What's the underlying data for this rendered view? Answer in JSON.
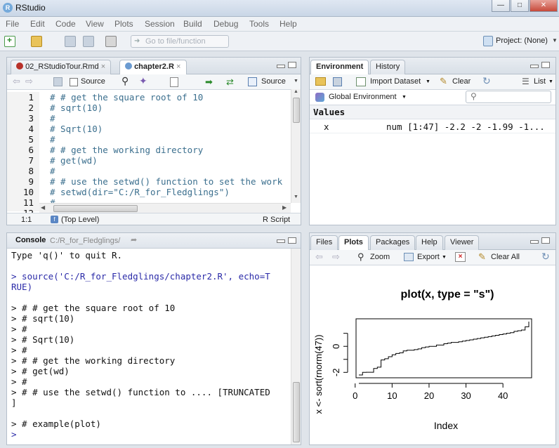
{
  "app": {
    "title": "RStudio"
  },
  "menu": [
    "File",
    "Edit",
    "Code",
    "View",
    "Plots",
    "Session",
    "Build",
    "Debug",
    "Tools",
    "Help"
  ],
  "toolbar": {
    "goto_placeholder": "Go to file/function",
    "project": "Project: (None)"
  },
  "editor": {
    "tabs": [
      "02_RStudioTour.Rmd",
      "chapter2.R"
    ],
    "source_on_save": "Source",
    "source_button": "Source",
    "line_numbers": [
      "1",
      "2",
      "3",
      "4",
      "5",
      "6",
      "7",
      "8",
      "9",
      "10",
      "11",
      "12"
    ],
    "lines": [
      "# # get the square root of 10",
      "# sqrt(10)",
      "#",
      "# Sqrt(10)",
      "#",
      "# # get the working directory",
      "# get(wd)",
      "#",
      "# # use the setwd() function to set the work",
      "# setwd(dir=\"C:/R_for_Fledglings\")",
      "#",
      ""
    ],
    "status_pos": "1:1",
    "status_scope": "(Top Level)",
    "status_type": "R Script"
  },
  "console": {
    "label": "Console",
    "path": "C:/R_for_Fledglings/",
    "lines": [
      {
        "t": "out",
        "v": "Type 'q()' to quit R."
      },
      {
        "t": "out",
        "v": ""
      },
      {
        "t": "in",
        "v": "> source('C:/R_for_Fledglings/chapter2.R', echo=T"
      },
      {
        "t": "in",
        "v": "RUE)"
      },
      {
        "t": "out",
        "v": ""
      },
      {
        "t": "out",
        "v": "> # # get the square root of 10"
      },
      {
        "t": "out",
        "v": "> # sqrt(10)"
      },
      {
        "t": "out",
        "v": "> #"
      },
      {
        "t": "out",
        "v": "> # Sqrt(10)"
      },
      {
        "t": "out",
        "v": "> #"
      },
      {
        "t": "out",
        "v": "> # # get the working directory"
      },
      {
        "t": "out",
        "v": "> # get(wd)"
      },
      {
        "t": "out",
        "v": "> #"
      },
      {
        "t": "out",
        "v": "> # # use the setwd() function to .... [TRUNCATED"
      },
      {
        "t": "out",
        "v": "]"
      },
      {
        "t": "out",
        "v": ""
      },
      {
        "t": "out",
        "v": "> # example(plot)"
      },
      {
        "t": "in",
        "v": "> "
      }
    ]
  },
  "env": {
    "tabs": [
      "Environment",
      "History"
    ],
    "import": "Import Dataset",
    "clear": "Clear",
    "view_mode": "List",
    "scope": "Global Environment",
    "section": "Values",
    "var_name": "x",
    "var_value": "num [1:47] -2.2 -2 -1.99 -1..."
  },
  "files": {
    "tabs": [
      "Files",
      "Plots",
      "Packages",
      "Help",
      "Viewer"
    ],
    "zoom": "Zoom",
    "export": "Export",
    "clear_all": "Clear All"
  },
  "chart_data": {
    "type": "line",
    "title": "plot(x, type = \"s\")",
    "xlabel": "Index",
    "ylabel": "x <- sort(rnorm(47))",
    "xlim": [
      1,
      47
    ],
    "ylim": [
      -2.2,
      1.9
    ],
    "xticks": [
      0,
      10,
      20,
      30,
      40
    ],
    "yticks": [
      -2,
      0
    ],
    "x": [
      1,
      2,
      3,
      4,
      5,
      6,
      7,
      8,
      9,
      10,
      11,
      12,
      13,
      14,
      15,
      16,
      17,
      18,
      19,
      20,
      21,
      22,
      23,
      24,
      25,
      26,
      27,
      28,
      29,
      30,
      31,
      32,
      33,
      34,
      35,
      36,
      37,
      38,
      39,
      40,
      41,
      42,
      43,
      44,
      45,
      46,
      47
    ],
    "values": [
      -2.2,
      -2.0,
      -1.99,
      -1.99,
      -1.7,
      -1.6,
      -1.05,
      -0.95,
      -0.8,
      -0.65,
      -0.55,
      -0.5,
      -0.35,
      -0.3,
      -0.3,
      -0.25,
      -0.2,
      -0.1,
      -0.05,
      0.0,
      0.0,
      0.1,
      0.1,
      0.2,
      0.25,
      0.3,
      0.3,
      0.35,
      0.4,
      0.45,
      0.5,
      0.55,
      0.6,
      0.65,
      0.7,
      0.75,
      0.8,
      0.85,
      0.9,
      0.95,
      1.0,
      1.05,
      1.15,
      1.2,
      1.25,
      1.5,
      1.9
    ]
  }
}
